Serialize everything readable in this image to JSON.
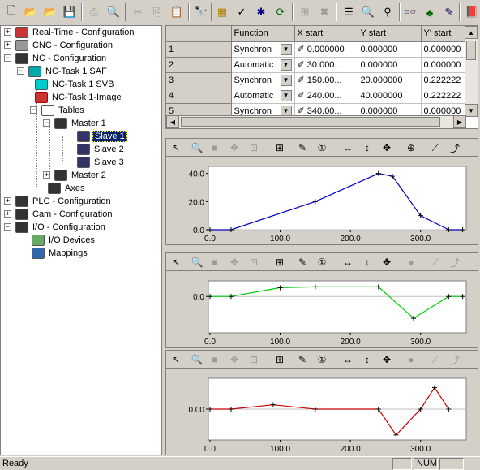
{
  "tree": {
    "items": [
      {
        "label": "Real-Time - Configuration"
      },
      {
        "label": "CNC - Configuration"
      },
      {
        "label": "NC - Configuration"
      },
      {
        "label": "NC-Task 1 SAF"
      },
      {
        "label": "NC-Task 1 SVB"
      },
      {
        "label": "NC-Task 1-Image"
      },
      {
        "label": "Tables"
      },
      {
        "label": "Master 1"
      },
      {
        "label": "Slave 1"
      },
      {
        "label": "Slave 2"
      },
      {
        "label": "Slave 3"
      },
      {
        "label": "Master 2"
      },
      {
        "label": "Axes"
      },
      {
        "label": "PLC - Configuration"
      },
      {
        "label": "Cam - Configuration"
      },
      {
        "label": "I/O - Configuration"
      },
      {
        "label": "I/O Devices"
      },
      {
        "label": "Mappings"
      }
    ]
  },
  "table": {
    "headers": [
      "Function",
      "X start",
      "Y start",
      "Y' start"
    ],
    "rows": [
      {
        "num": "1",
        "function": "Synchron",
        "x": "0.000000",
        "y": "0.000000",
        "yp": "0.000000"
      },
      {
        "num": "2",
        "function": "Automatic",
        "x": "30.000...",
        "y": "0.000000",
        "yp": "0.000000"
      },
      {
        "num": "3",
        "function": "Synchron",
        "x": "150.00...",
        "y": "20.000000",
        "yp": "0.222222"
      },
      {
        "num": "4",
        "function": "Automatic",
        "x": "240.00...",
        "y": "40.000000",
        "yp": "0.222222"
      },
      {
        "num": "5",
        "function": "Synchron",
        "x": "340.00...",
        "y": "0.000000",
        "yp": "0.000000"
      }
    ]
  },
  "charts": {
    "xticks": [
      "0.0",
      "100.0",
      "200.0",
      "300.0"
    ],
    "plot1": {
      "yticks": [
        "40.0",
        "20.0",
        "0.0"
      ],
      "color": "#0000cc"
    },
    "plot2": {
      "yticks": [
        "0.0"
      ],
      "color": "#00cc00"
    },
    "plot3": {
      "yticks": [
        "0.00"
      ],
      "color": "#cc0000"
    }
  },
  "chart_data": [
    {
      "type": "line",
      "series": [
        {
          "x": [
            0,
            30,
            150,
            240,
            260,
            300,
            340,
            360
          ],
          "y": [
            0,
            0,
            20,
            40,
            38,
            10,
            0,
            0
          ]
        }
      ],
      "ylim": [
        0,
        45
      ],
      "xlim": [
        0,
        360
      ]
    },
    {
      "type": "line",
      "series": [
        {
          "x": [
            0,
            30,
            100,
            150,
            240,
            290,
            340,
            360
          ],
          "y": [
            0,
            0,
            0.2,
            0.22,
            0.22,
            -0.5,
            0,
            0
          ]
        }
      ],
      "xlim": [
        0,
        360
      ]
    },
    {
      "type": "line",
      "series": [
        {
          "x": [
            0,
            30,
            90,
            150,
            240,
            265,
            300,
            320,
            340
          ],
          "y": [
            0,
            0,
            0.1,
            0,
            0,
            -0.6,
            0,
            0.5,
            0
          ]
        }
      ],
      "xlim": [
        0,
        360
      ]
    }
  ],
  "status": {
    "text": "Ready",
    "num": "NUM"
  }
}
